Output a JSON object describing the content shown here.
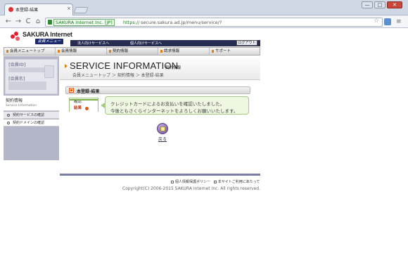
{
  "browser": {
    "tab_title": "本登録-結果",
    "tab_close": "×",
    "window_controls": {
      "minimize": "—",
      "maximize": "□",
      "close": "✕"
    },
    "nav": {
      "back": "←",
      "forward": "→",
      "reload": "C",
      "home": "⌂"
    },
    "ev_label": "SAKURA Internet Inc. [JP]",
    "url_scheme": "https://",
    "url_rest": "secure.sakura.ad.jp/menu/service/?",
    "icons": {
      "lock": "lock-icon",
      "star": "star-icon",
      "menu": "menu-icon"
    }
  },
  "site": {
    "logo_name": "SAKURA Internet",
    "logo_sub": "会員メニュー",
    "topbar_links": [
      "法人向けサービスへ",
      "個人向けサービスへ"
    ],
    "logout": "ログアウト",
    "main_nav": [
      "会員メニュートップ",
      "会員情報",
      "契約情報",
      "請求情報",
      "サポート"
    ],
    "active_nav": "契約情報"
  },
  "sidebar": {
    "member_id_label": "[会員ID]",
    "member_name_label": "[会員名]",
    "section_title": "契約情報",
    "section_subtitle": "Service Information",
    "links": [
      "契約サービスの確認",
      "契約ドメインの確認"
    ]
  },
  "content": {
    "title": "SERVICE INFORMATION",
    "title_sub": "契約情報",
    "breadcrumb": "会員メニュートップ ＞ 契約情報 ＞ 本登録-結果",
    "section_title": "本登録-結果",
    "steps": [
      "確認",
      "結果"
    ],
    "message_lines": [
      "クレジットカードによるお支払いを確認いたしました。",
      "今後ともさくらインターネットをよろしくお願いいたします。"
    ],
    "back_label": "戻る"
  },
  "footer": {
    "links": [
      "個人情報保護ポリシー",
      "本サイトご利用にあたって"
    ],
    "copyright": "Copyright(C) 2006-2015 SAKURA Internet Inc. All rights reserved."
  },
  "colors": {
    "accent_orange": "#e08010",
    "nav_dark": "#272d52",
    "sidebar": "#b3b6c8",
    "message_bg": "#eef7e2"
  }
}
